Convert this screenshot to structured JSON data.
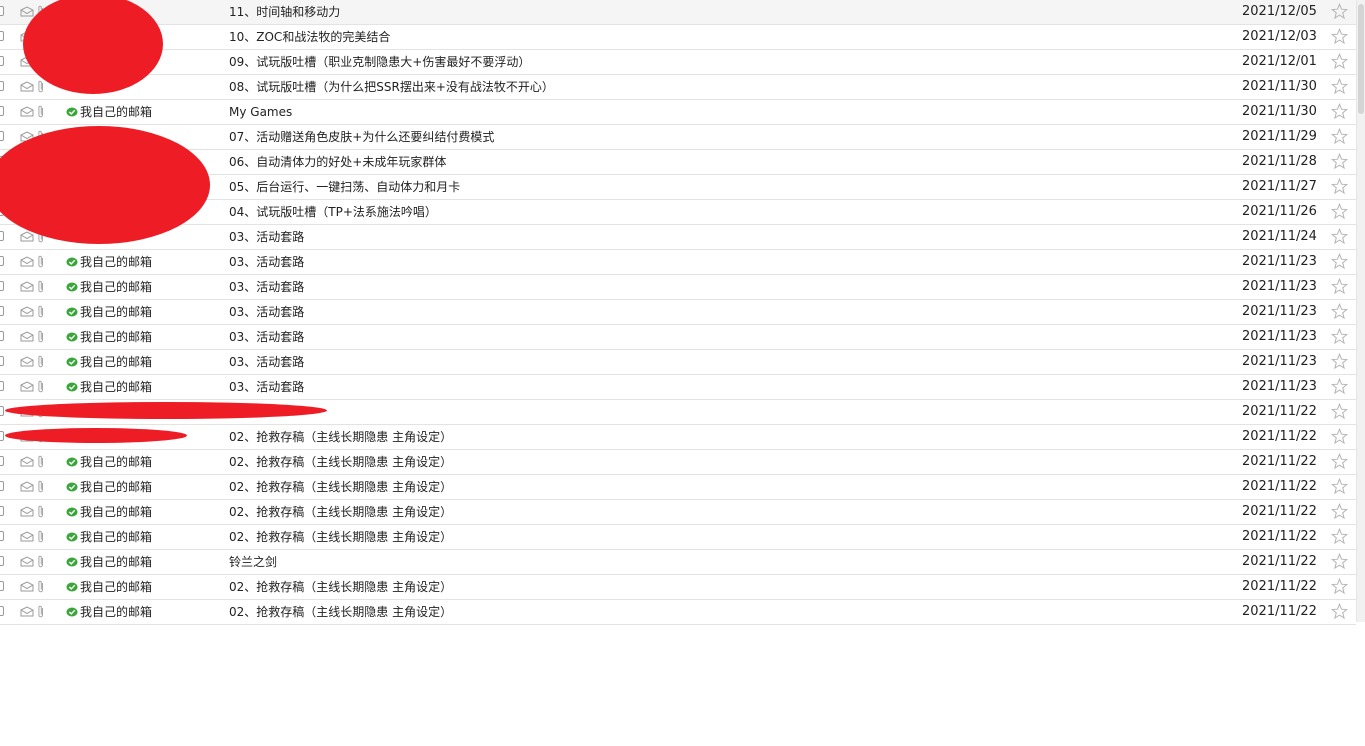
{
  "mail_list": {
    "rows": [
      {
        "sender": "",
        "subject": "11、时间轴和移动力",
        "date": "2021/12/05"
      },
      {
        "sender": "",
        "subject": "10、ZOC和战法牧的完美结合",
        "date": "2021/12/03"
      },
      {
        "sender": "",
        "subject": "09、试玩版吐槽（职业克制隐患大+伤害最好不要浮动）",
        "date": "2021/12/01"
      },
      {
        "sender": "",
        "subject": "08、试玩版吐槽（为什么把SSR摆出来+没有战法牧不开心）",
        "date": "2021/11/30"
      },
      {
        "sender": "我自己的邮箱",
        "subject": "My Games",
        "date": "2021/11/30"
      },
      {
        "sender": "",
        "subject": "07、活动赠送角色皮肤+为什么还要纠结付费模式",
        "date": "2021/11/29"
      },
      {
        "sender": "",
        "subject": "06、自动清体力的好处+未成年玩家群体",
        "date": "2021/11/28"
      },
      {
        "sender": "",
        "subject": "05、后台运行、一键扫荡、自动体力和月卡",
        "date": "2021/11/27"
      },
      {
        "sender": "",
        "subject": "04、试玩版吐槽（TP+法系施法吟唱）",
        "date": "2021/11/26"
      },
      {
        "sender": "",
        "subject": "03、活动套路",
        "date": "2021/11/24"
      },
      {
        "sender": "我自己的邮箱",
        "subject": "03、活动套路",
        "date": "2021/11/23"
      },
      {
        "sender": "我自己的邮箱",
        "subject": "03、活动套路",
        "date": "2021/11/23"
      },
      {
        "sender": "我自己的邮箱",
        "subject": "03、活动套路",
        "date": "2021/11/23"
      },
      {
        "sender": "我自己的邮箱",
        "subject": "03、活动套路",
        "date": "2021/11/23"
      },
      {
        "sender": "我自己的邮箱",
        "subject": "03、活动套路",
        "date": "2021/11/23"
      },
      {
        "sender": "我自己的邮箱",
        "subject": "03、活动套路",
        "date": "2021/11/23"
      },
      {
        "sender": "",
        "subject": "",
        "date": "2021/11/22"
      },
      {
        "sender": "",
        "subject": "02、抢救存稿（主线长期隐患 主角设定）",
        "date": "2021/11/22"
      },
      {
        "sender": "我自己的邮箱",
        "subject": "02、抢救存稿（主线长期隐患 主角设定）",
        "date": "2021/11/22"
      },
      {
        "sender": "我自己的邮箱",
        "subject": "02、抢救存稿（主线长期隐患 主角设定）",
        "date": "2021/11/22"
      },
      {
        "sender": "我自己的邮箱",
        "subject": "02、抢救存稿（主线长期隐患 主角设定）",
        "date": "2021/11/22"
      },
      {
        "sender": "我自己的邮箱",
        "subject": "02、抢救存稿（主线长期隐患 主角设定）",
        "date": "2021/11/22"
      },
      {
        "sender": "我自己的邮箱",
        "subject": "铃兰之剑",
        "date": "2021/11/22"
      },
      {
        "sender": "我自己的邮箱",
        "subject": "02、抢救存稿（主线长期隐患 主角设定）",
        "date": "2021/11/22"
      },
      {
        "sender": "我自己的邮箱",
        "subject": "02、抢救存稿（主线长期隐患 主角设定）",
        "date": "2021/11/22"
      }
    ]
  },
  "colors": {
    "redaction": "#ee1c25",
    "sender_ok_icon": "#3aa63a",
    "row_border": "#e3e3e3"
  },
  "icons": {
    "read_status": "envelope-open-icon",
    "attachment": "paperclip-icon",
    "sender_verified": "check-badge-icon",
    "favorite": "star-outline-icon"
  }
}
